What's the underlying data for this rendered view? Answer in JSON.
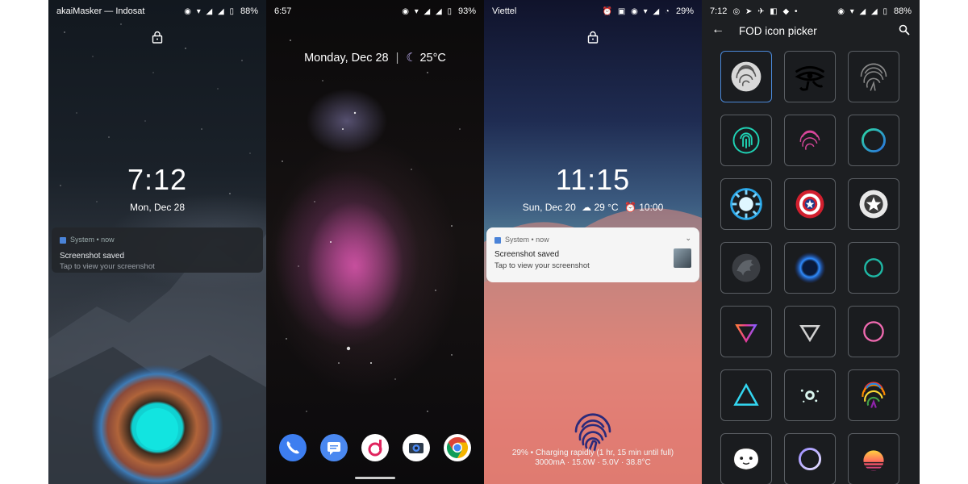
{
  "screen1": {
    "status_left": "akaiMasker — Indosat",
    "battery": "88%",
    "time": "7:12",
    "date": "Mon, Dec 28",
    "notification": {
      "app": "System • now",
      "title": "Screenshot saved",
      "text": "Tap to view your screenshot"
    }
  },
  "screen2": {
    "status_time": "6:57",
    "battery": "93%",
    "date_weather": "Monday, Dec 28",
    "temperature": "25°C",
    "dock": [
      "phone-icon",
      "messages-icon",
      "music-icon",
      "camera-icon",
      "chrome-icon"
    ]
  },
  "screen3": {
    "carrier": "Viettel",
    "battery": "29%",
    "time": "11:15",
    "date": "Sun, Dec 20",
    "temperature": "29 °C",
    "alarm": "10:00",
    "notification": {
      "app": "System • now",
      "title": "Screenshot saved",
      "text": "Tap to view your screenshot"
    },
    "charging_line1": "29% • Charging rapidly (1 hr, 15 min until full)",
    "charging_line2": "3000mA · 15.0W · 5.0V · 38.8°C"
  },
  "screen4": {
    "status_time": "7:12",
    "battery": "88%",
    "title": "FOD icon picker",
    "icons": [
      "fingerprint-gray-selected",
      "eye-of-horus",
      "fingerprint-outline",
      "fingerprint-teal",
      "fingerprint-pink",
      "ring-gradient",
      "arc-reactor",
      "captain-america-shield",
      "star-badge",
      "dragon-emblem",
      "blue-energy-ring",
      "teal-ring",
      "triangle-down-gradient",
      "triangle-down-white",
      "pink-ring",
      "triangle-cyan",
      "alien-pulse",
      "fingerprint-rainbow",
      "bt21-character",
      "purple-swirl-ring",
      "retro-sunset"
    ]
  }
}
